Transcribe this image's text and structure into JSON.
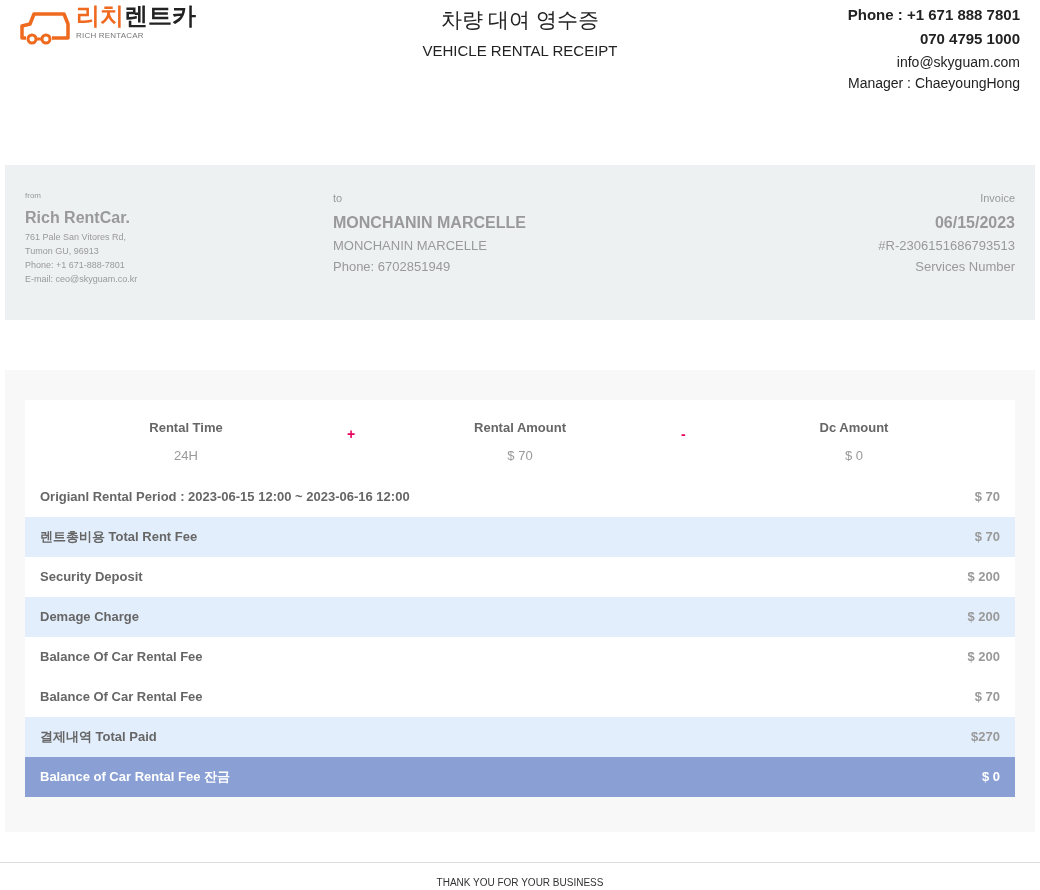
{
  "logo": {
    "mark_orange": "리치",
    "mark_dark": "렌트카",
    "subtitle": "RICH RENTACAR"
  },
  "title": {
    "korean": "차량 대여 영수증",
    "english": "VEHICLE RENTAL RECEIPT"
  },
  "contact": {
    "phone": "Phone : +1 671 888 7801",
    "phone_2": "070 4795 1000",
    "email": "info@skyguam.com",
    "manager": "Manager : ChaeyoungHong"
  },
  "from": {
    "label": "from",
    "name": "Rich RentCar.",
    "lines": [
      "761 Pale San Vitores Rd,",
      "Tumon GU, 96913",
      "Phone: +1 671-888-7801",
      "E-mail: ceo@skyguam.co.kr"
    ]
  },
  "to": {
    "label": "to",
    "name": "MONCHANIN MARCELLE",
    "lines": [
      "MONCHANIN MARCELLE",
      "Phone: 6702851949"
    ]
  },
  "invoice": {
    "label": "Invoice",
    "date": "06/15/2023",
    "number": "#R-2306151686793513",
    "services": "Services Number"
  },
  "summary": [
    {
      "label": "Rental Time",
      "value": "24H"
    },
    {
      "operator": "+"
    },
    {
      "label": "Rental Amount",
      "value": "$ 70"
    },
    {
      "operator": "-"
    },
    {
      "label": "Dc Amount",
      "value": "$ 0"
    }
  ],
  "rows": [
    {
      "kind": "plain",
      "label": "Origianl Rental Period : 2023-06-15 12:00 ~ 2023-06-16 12:00",
      "amount": "$ 70"
    },
    {
      "kind": "shaded",
      "label": "렌트총비용 Total Rent Fee",
      "amount": "$ 70"
    },
    {
      "kind": "plain",
      "label": "Security Deposit",
      "amount": "$ 200"
    },
    {
      "kind": "shaded",
      "label": "Demage Charge",
      "amount": "$ 200"
    },
    {
      "kind": "plain",
      "label": "Balance Of Car Rental Fee",
      "amount": "$ 200"
    },
    {
      "kind": "plain",
      "label": "Balance Of Car Rental Fee",
      "amount": "$ 70"
    },
    {
      "kind": "shaded",
      "label": "결제내역 Total Paid",
      "amount": "$270"
    },
    {
      "kind": "total",
      "label": "Balance of Car Rental Fee 잔금",
      "amount": "$ 0"
    }
  ],
  "footer": "THANK YOU FOR YOUR BUSINESS"
}
